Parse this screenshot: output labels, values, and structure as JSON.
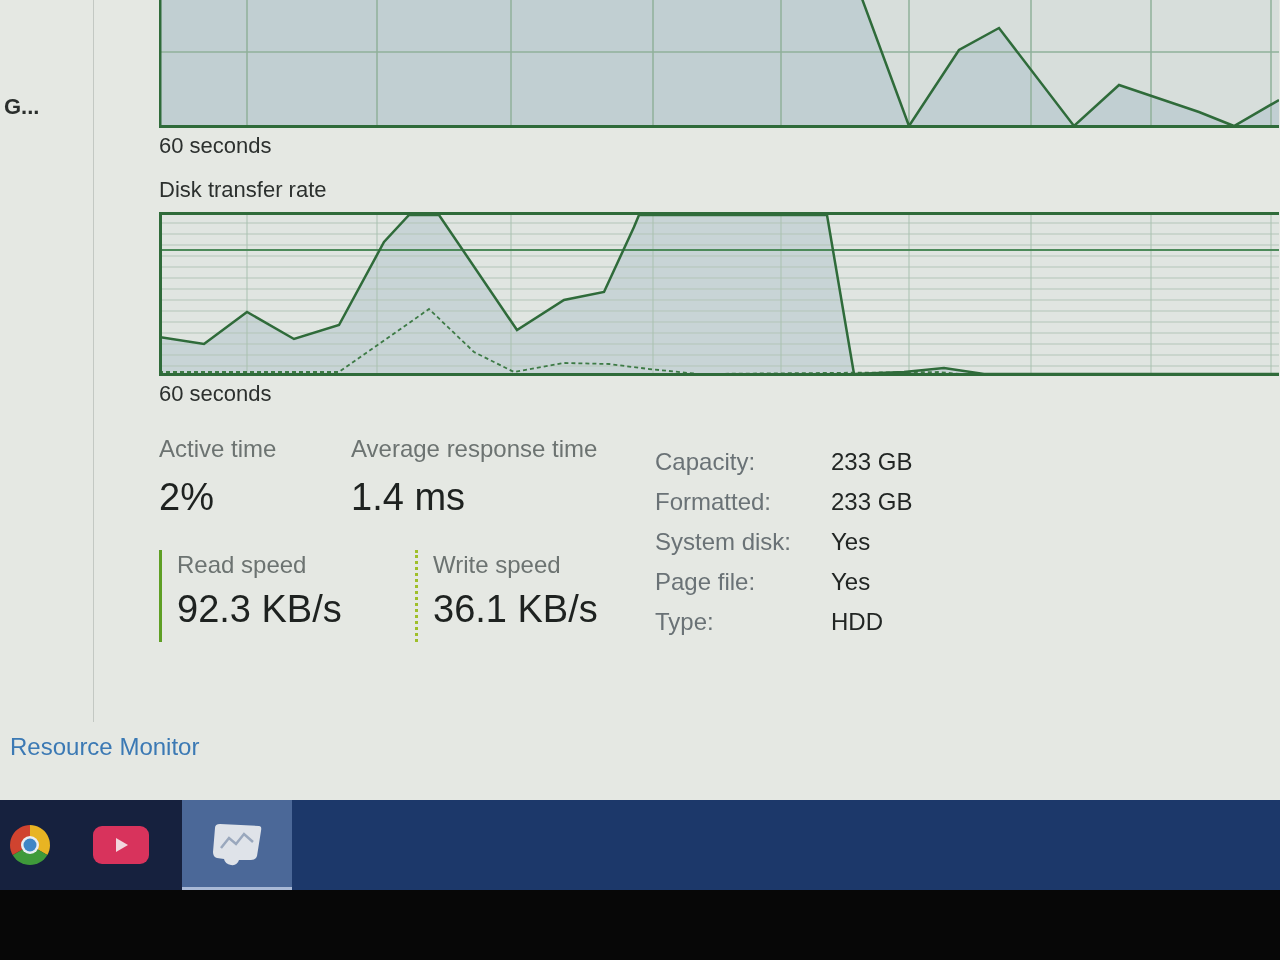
{
  "sidebar": {
    "items": [
      {
        "label": "G..."
      }
    ]
  },
  "active_time_graph": {
    "time_label": "60 seconds"
  },
  "disk_transfer_rate_graph": {
    "title": "Disk transfer rate",
    "time_label": "60 seconds"
  },
  "stats": [
    {
      "label": "Active time",
      "value": "2%"
    },
    {
      "label": "Average response time",
      "value": "1.4 ms"
    }
  ],
  "speeds": [
    {
      "label": "Read speed",
      "value": "92.3 KB/s",
      "kind": "solid"
    },
    {
      "label": "Write speed",
      "value": "36.1 KB/s",
      "kind": "dotted"
    }
  ],
  "properties": [
    {
      "label": "Capacity:",
      "value": "233 GB"
    },
    {
      "label": "Formatted:",
      "value": "233 GB"
    },
    {
      "label": "System disk:",
      "value": "Yes"
    },
    {
      "label": "Page file:",
      "value": "Yes"
    },
    {
      "label": "Type:",
      "value": "HDD"
    }
  ],
  "footer": {
    "link": "Resource Monitor"
  },
  "taskbar": {
    "items": [
      {
        "kind": "browser",
        "selected": false
      },
      {
        "kind": "video",
        "selected": false
      },
      {
        "kind": "monitor",
        "selected": true
      }
    ]
  }
}
